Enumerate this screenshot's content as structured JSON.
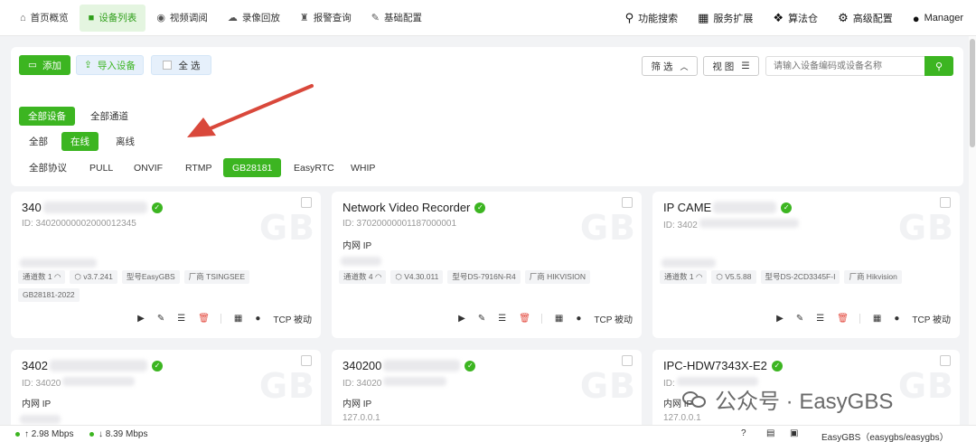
{
  "nav": {
    "items": [
      {
        "label": "首页概览",
        "icon": "home-icon",
        "glyph": "⌂"
      },
      {
        "label": "设备列表",
        "icon": "video-camera-icon",
        "glyph": "■"
      },
      {
        "label": "视频调阅",
        "icon": "play-circle-icon",
        "glyph": "◉"
      },
      {
        "label": "录像回放",
        "icon": "cloud-icon",
        "glyph": "☁"
      },
      {
        "label": "报警查询",
        "icon": "alarm-icon",
        "glyph": "♜"
      },
      {
        "label": "基础配置",
        "icon": "wrench-icon",
        "glyph": "✎"
      }
    ],
    "right": [
      {
        "label": "功能搜索",
        "icon": "search-icon",
        "glyph": "⚲"
      },
      {
        "label": "服务扩展",
        "icon": "grid-icon",
        "glyph": "▦"
      },
      {
        "label": "算法仓",
        "icon": "dropbox-icon",
        "glyph": "❖"
      },
      {
        "label": "高级配置",
        "icon": "gear-icon",
        "glyph": "⚙"
      },
      {
        "label": "Manager",
        "icon": "user-icon",
        "glyph": "●"
      }
    ]
  },
  "toolbar": {
    "add": "添加",
    "import": "导入设备",
    "select_all": "全 选",
    "filter": "筛 选",
    "view": "视 图",
    "search_placeholder": "请输入设备编码或设备名称"
  },
  "filters": {
    "scope": [
      "全部设备",
      "全部通道"
    ],
    "status": [
      "全部",
      "在线",
      "离线"
    ],
    "protocols": [
      "全部协议",
      "PULL",
      "ONVIF",
      "RTMP",
      "GB28181",
      "EasyRTC",
      "WHIP"
    ]
  },
  "cards": [
    {
      "title": "340",
      "id": "ID: 34020000002000012345",
      "ip": "",
      "tags": [
        "通道数 1",
        "v3.7.241",
        "型号EasyGBS",
        "厂商 TSINGSEE",
        "GB28181-2022"
      ],
      "tcp": "TCP 被动"
    },
    {
      "title": "Network Video Recorder",
      "id": "ID: 37020000001187000001",
      "ip": "内网 IP",
      "tags": [
        "通道数 4",
        "V4.30.011",
        "型号DS-7916N-R4",
        "厂商 HIKVISION"
      ],
      "tcp": "TCP 被动"
    },
    {
      "title": "IP CAME",
      "id": "ID: 3402",
      "ip": "",
      "tags": [
        "通道数 1",
        "V5.5.88",
        "型号DS-2CD3345F-I",
        "厂商 Hikvision"
      ],
      "tcp": "TCP 被动"
    },
    {
      "title": "3402",
      "id": "ID: 34020",
      "ip": "内网 IP",
      "ip_val": ""
    },
    {
      "title": "340200",
      "id": "ID: 34020",
      "ip": "内网 IP",
      "ip_val": "127.0.0.1"
    },
    {
      "title": "IPC-HDW7343X-E2",
      "id": "ID:",
      "ip": "内网 IP",
      "ip_val": "127.0.0.1"
    }
  ],
  "status": {
    "upload": "2.98 Mbps",
    "download": "8.39 Mbps",
    "app": "EasyGBS（easygbs/easygbs）"
  },
  "watermark": "公众号 · EasyGBS",
  "colors": {
    "accent": "#3cb521",
    "arrow": "#d9483b"
  }
}
